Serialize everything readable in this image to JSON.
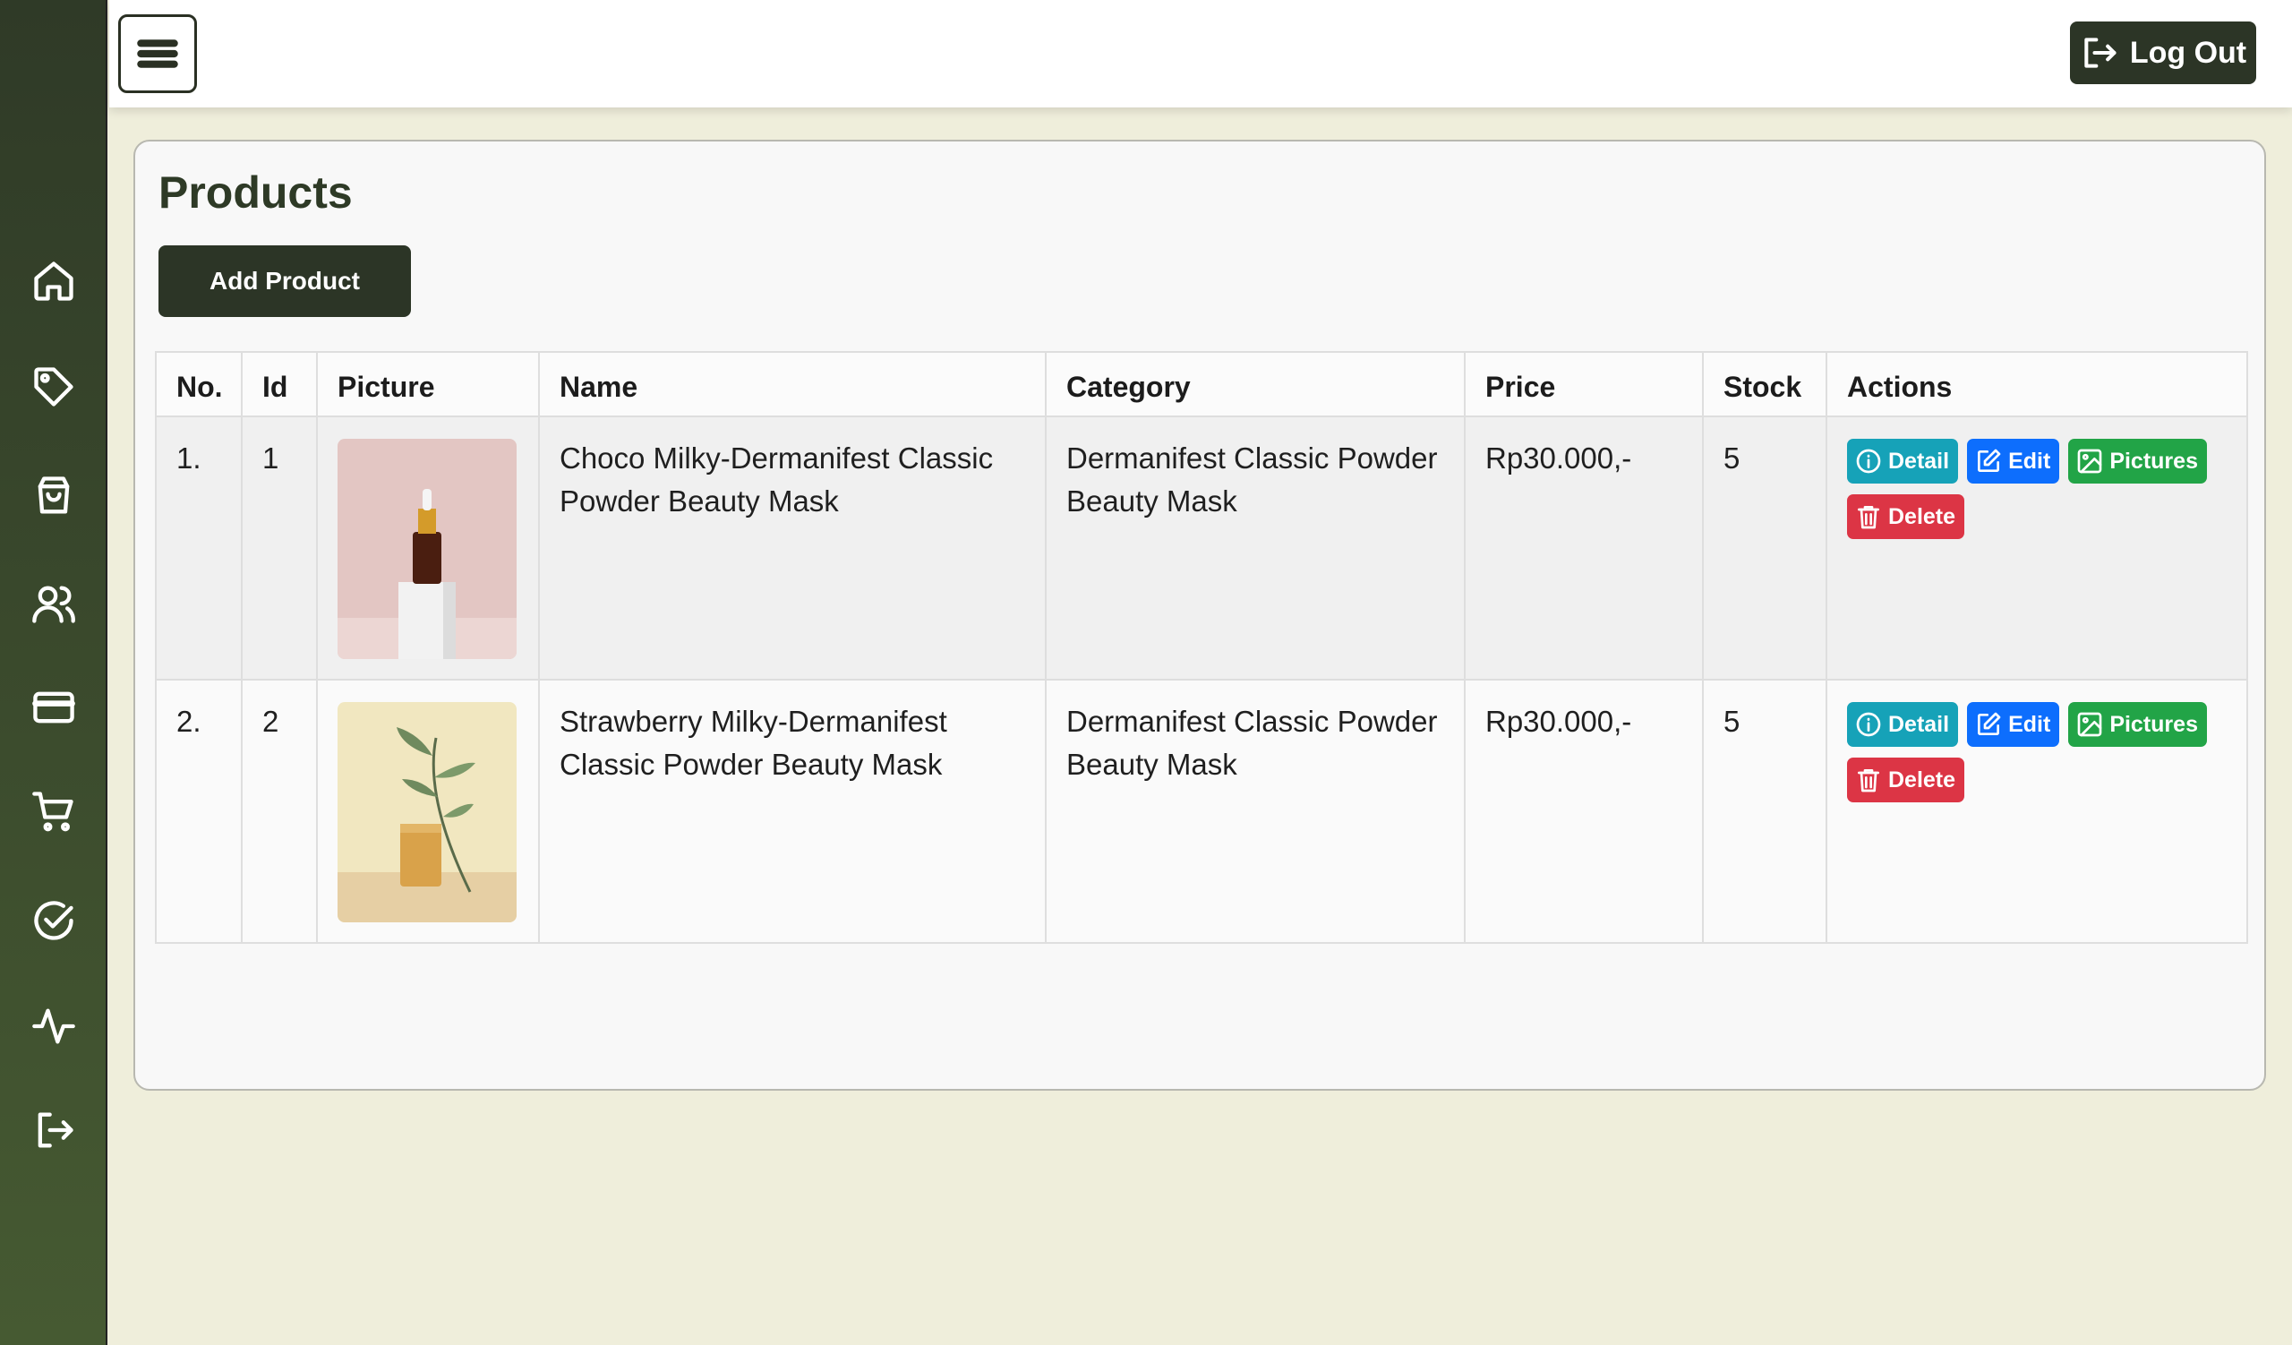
{
  "topbar": {
    "logout_label": "Log Out"
  },
  "sidebar": {
    "items": [
      {
        "icon": "home-icon"
      },
      {
        "icon": "tag-icon"
      },
      {
        "icon": "shopping-bag-icon"
      },
      {
        "icon": "users-icon"
      },
      {
        "icon": "credit-card-icon"
      },
      {
        "icon": "cart-icon"
      },
      {
        "icon": "check-circle-icon"
      },
      {
        "icon": "activity-icon"
      },
      {
        "icon": "logout-icon"
      }
    ]
  },
  "main": {
    "title": "Products",
    "add_button_label": "Add Product",
    "table": {
      "headers": [
        "No.",
        "Id",
        "Picture",
        "Name",
        "Category",
        "Price",
        "Stock",
        "Actions"
      ],
      "rows": [
        {
          "no": "1.",
          "id": "1",
          "picture": "serum-bottle-image",
          "name": "Choco Milky-Dermanifest Classic Powder Beauty Mask",
          "category": "Dermanifest Classic Powder Beauty Mask",
          "price": "Rp30.000,-",
          "stock": "5"
        },
        {
          "no": "2.",
          "id": "2",
          "picture": "soap-bar-image",
          "name": "Strawberry Milky-Dermanifest Classic Powder Beauty Mask",
          "category": "Dermanifest Classic Powder Beauty Mask",
          "price": "Rp30.000,-",
          "stock": "5"
        }
      ],
      "actions": {
        "detail": "Detail",
        "edit": "Edit",
        "pictures": "Pictures",
        "delete": "Delete"
      }
    }
  },
  "colors": {
    "sidebar_top": "#2f3a27",
    "sidebar_bottom": "#465a32",
    "primary_dark": "#2c3526",
    "page_bg": "#efeedb",
    "detail": "#16a2b8",
    "edit": "#0d6efd",
    "pictures": "#22a447",
    "delete": "#dc3545"
  }
}
